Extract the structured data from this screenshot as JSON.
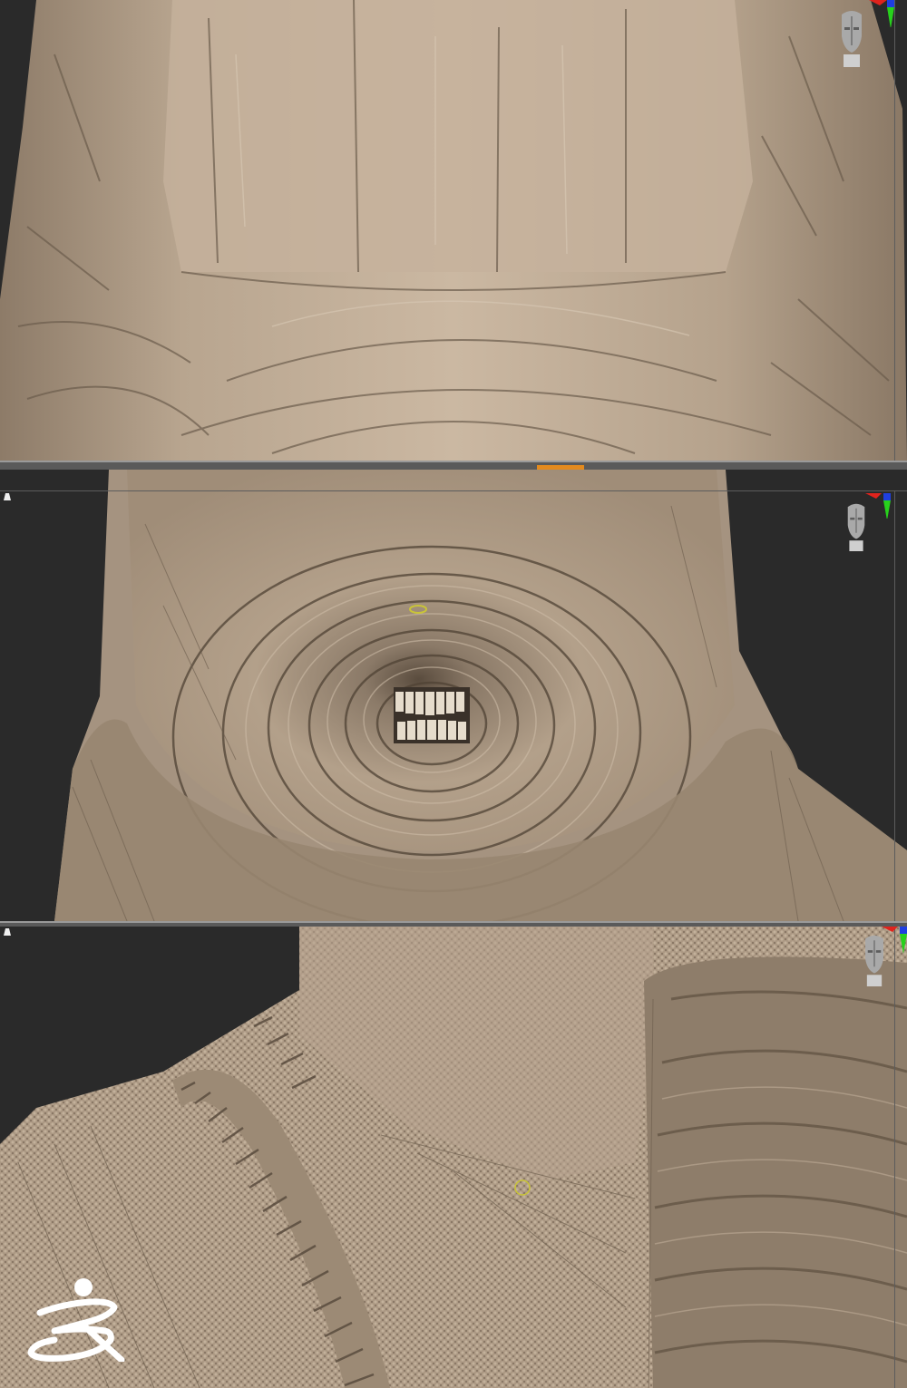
{
  "app": {
    "name": "ZBrush"
  },
  "colors": {
    "background": "#2a2a2a",
    "sculpt_base": "#b09d87",
    "sculpt_shadow": "#6b5c4c",
    "sculpt_highlight": "#d2c2ae",
    "split_handle": "#e38a1e",
    "axis_x": "#e0231d",
    "axis_y": "#27d11c",
    "axis_z": "#1f3fe0",
    "brush_cursor": "#c9c437"
  },
  "viewports": [
    {
      "id": "viewport-top",
      "icons": [
        "head-navigator-icon",
        "axis-gizmo-icon"
      ]
    },
    {
      "id": "viewport-middle",
      "icons": [
        "perspective-icon",
        "head-navigator-icon",
        "axis-gizmo-icon",
        "brush-cursor"
      ]
    },
    {
      "id": "viewport-bottom",
      "icons": [
        "perspective-icon",
        "head-navigator-icon",
        "axis-gizmo-icon",
        "brush-cursor"
      ]
    }
  ],
  "logo": {
    "icon": "zbrush-logo-icon"
  }
}
